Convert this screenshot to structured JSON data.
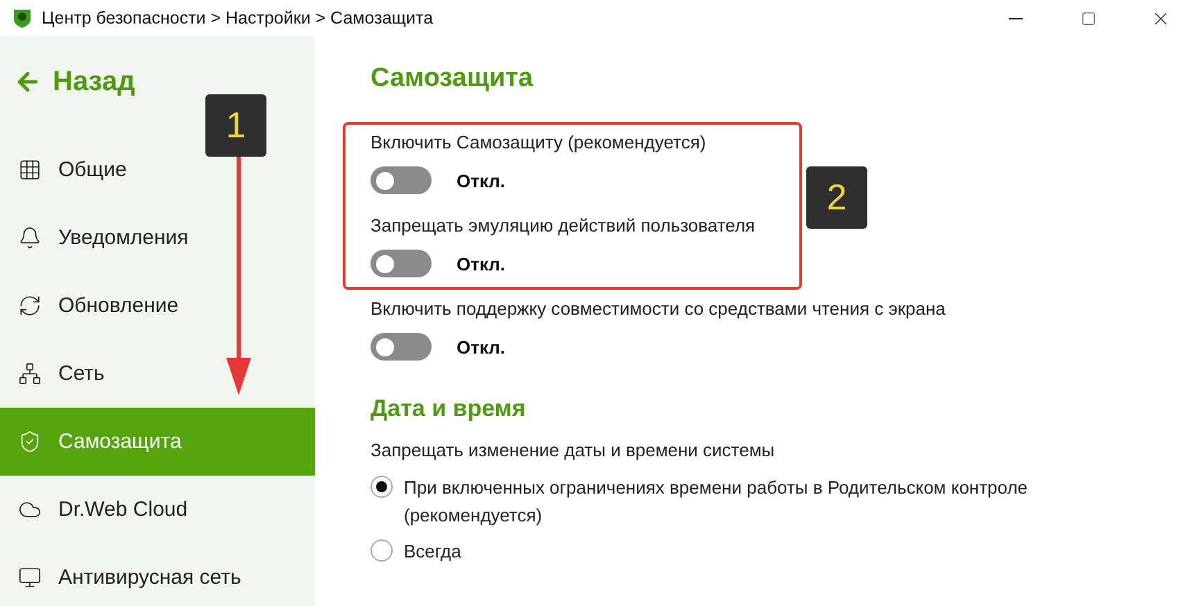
{
  "window": {
    "title": "Центр безопасности > Настройки > Самозащита"
  },
  "sidebar": {
    "back": "Назад",
    "items": [
      {
        "label": "Общие",
        "selected": false
      },
      {
        "label": "Уведомления",
        "selected": false
      },
      {
        "label": "Обновление",
        "selected": false
      },
      {
        "label": "Сеть",
        "selected": false
      },
      {
        "label": "Самозащита",
        "selected": true
      },
      {
        "label": "Dr.Web Cloud",
        "selected": false
      },
      {
        "label": "Антивирусная сеть",
        "selected": false
      }
    ]
  },
  "content": {
    "title": "Самозащита",
    "settings": [
      {
        "label": "Включить Самозащиту (рекомендуется)",
        "on": false,
        "state": "Откл."
      },
      {
        "label": "Запрещать эмуляцию действий пользователя",
        "on": false,
        "state": "Откл."
      },
      {
        "label": "Включить поддержку совместимости со средствами чтения с экрана",
        "on": false,
        "state": "Откл."
      }
    ],
    "date_section": {
      "title": "Дата и время",
      "label": "Запрещать изменение даты и времени системы",
      "options": [
        {
          "label": "При включенных ограничениях времени работы в Родительском контроле (рекомендуется)",
          "selected": true
        },
        {
          "label": "Всегда",
          "selected": false
        }
      ]
    }
  },
  "annotations": [
    "1",
    "2"
  ]
}
